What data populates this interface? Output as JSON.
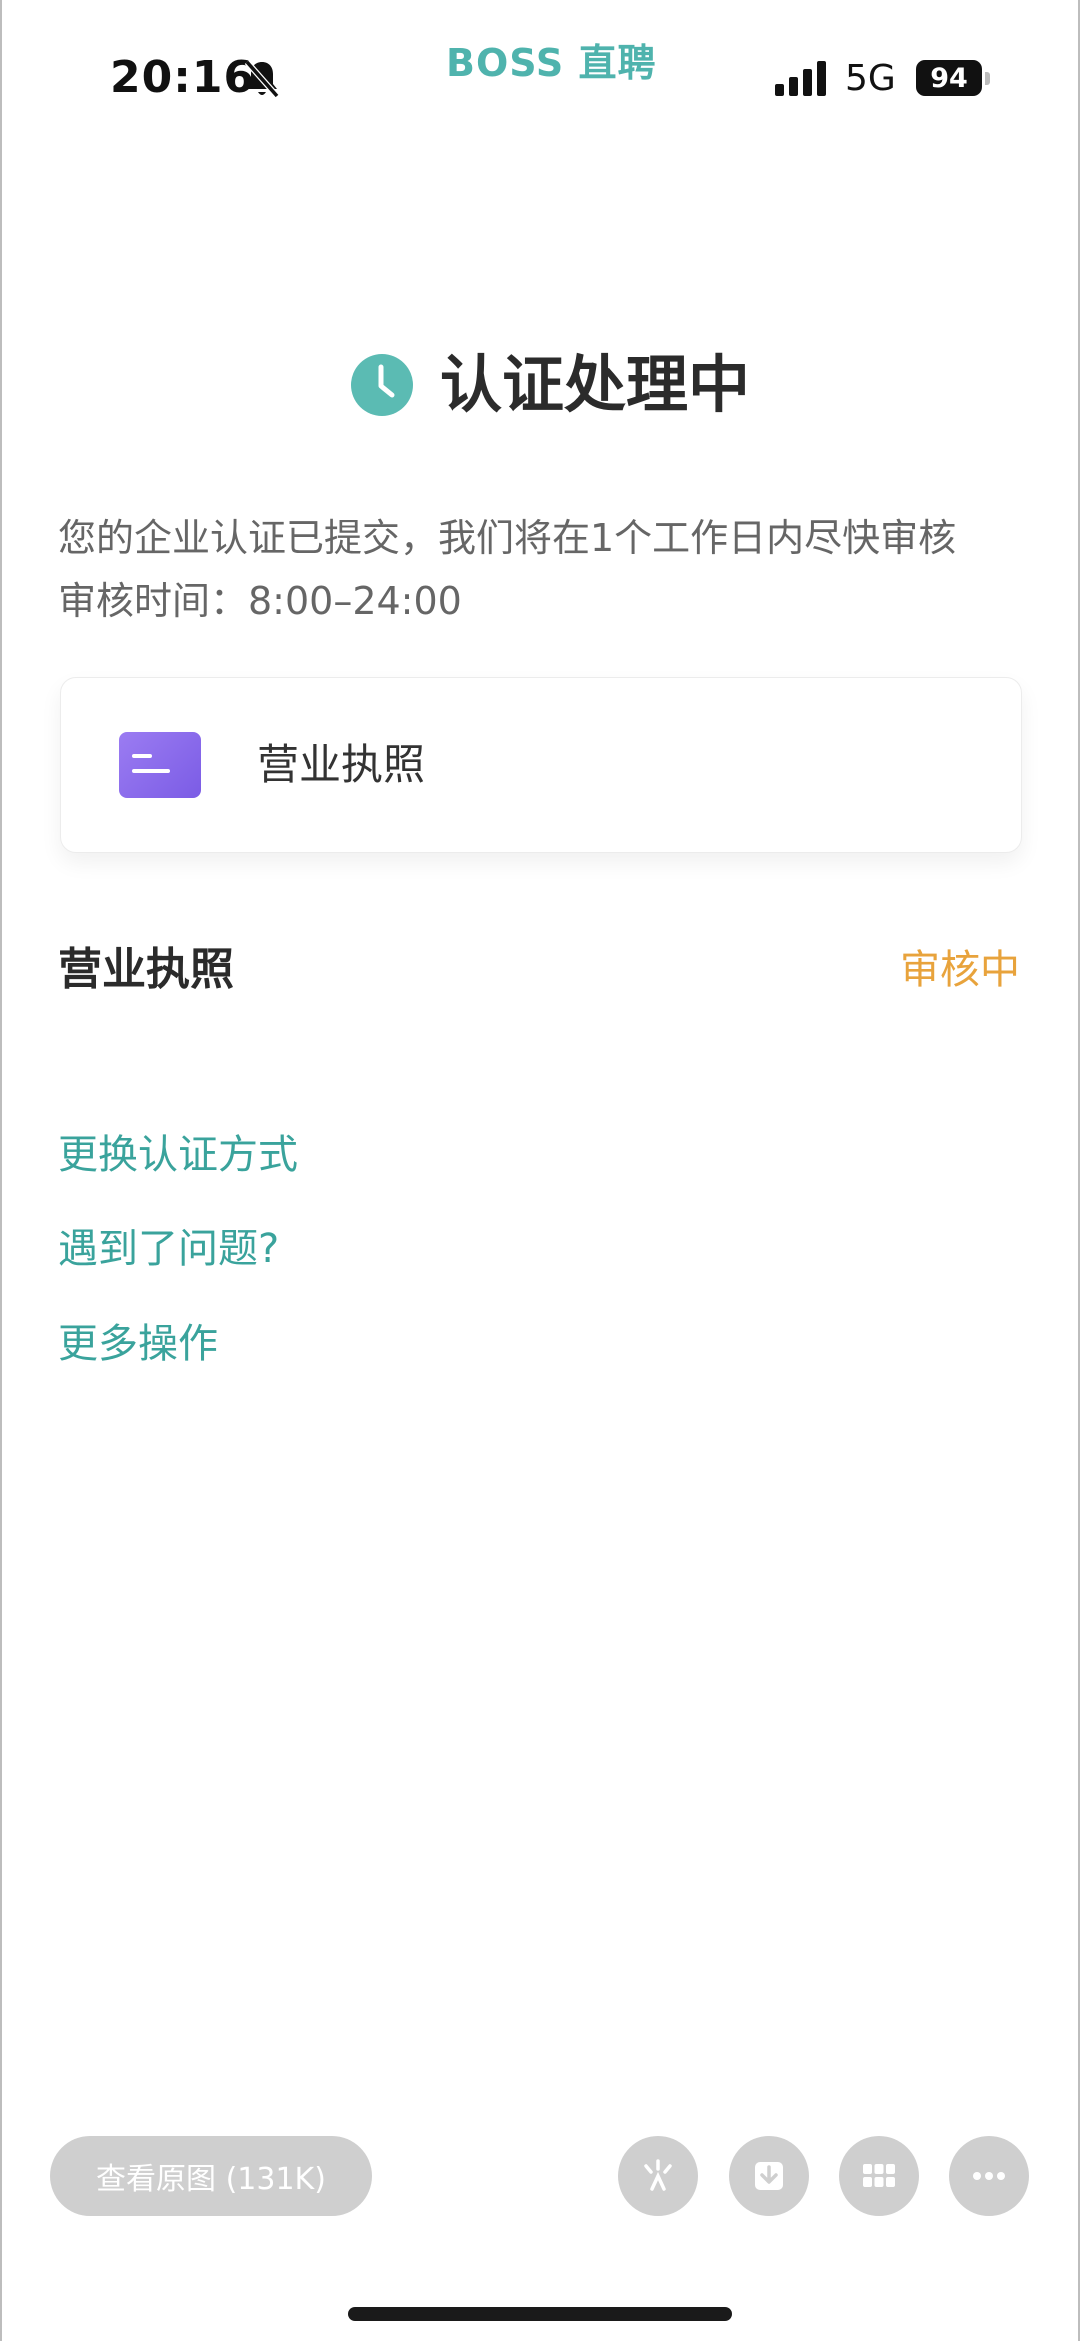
{
  "status_bar": {
    "time": "20:16",
    "network": "5G",
    "battery": "94"
  },
  "app": {
    "logo": "BOSS 直聘"
  },
  "header": {
    "title": "认证处理中",
    "icon": "clock-icon",
    "accent_color": "#5bbbb3"
  },
  "description": {
    "line1": "您的企业认证已提交，我们将在1个工作日内尽快审核",
    "line2": "审核时间：8:00–24:00"
  },
  "card": {
    "label": "营业执照",
    "icon": "document-icon"
  },
  "section": {
    "title": "营业执照",
    "status": "审核中",
    "status_color": "#e8a33c"
  },
  "links": [
    {
      "label": "更换认证方式"
    },
    {
      "label": "遇到了问题?"
    },
    {
      "label": "更多操作"
    }
  ],
  "link_color": "#3aa39c",
  "viewer_toolbar": {
    "view_original": "查看原图 (131K)",
    "buttons": [
      "sparkle-icon",
      "download-icon",
      "grid-icon",
      "more-icon"
    ]
  }
}
